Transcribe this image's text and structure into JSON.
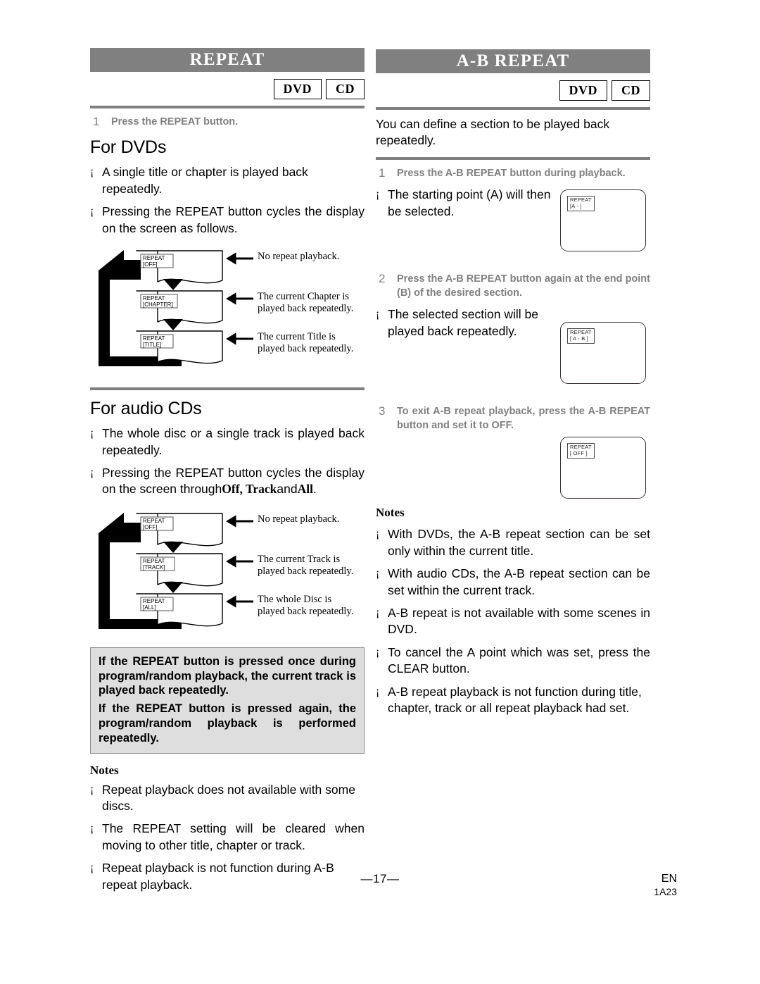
{
  "left_column": {
    "section_title": "REPEAT",
    "badges": [
      "DVD",
      "CD"
    ],
    "step1": {
      "num": "1",
      "text": "Press the REPEAT button."
    },
    "dvd_heading": "For DVDs",
    "dvd_bullets": [
      "A single title or chapter is played back repeatedly.",
      "Pressing the REPEAT button cycles the display on the screen as follows."
    ],
    "dvd_flow": {
      "items": [
        {
          "osd_line1": "REPEAT",
          "osd_line2": "[OFF]",
          "caption": "No repeat playback."
        },
        {
          "osd_line1": "REPEAT",
          "osd_line2": "[CHAPTER]",
          "caption": "The current Chapter is\nplayed back repeatedly."
        },
        {
          "osd_line1": "REPEAT",
          "osd_line2": "[TITLE]",
          "caption": "The current Title is\nplayed back repeatedly."
        }
      ]
    },
    "cd_heading": "For audio CDs",
    "cd_bullet1": "The whole disc or a single track is played back repeatedly.",
    "cd_bullet2_pre": "Pressing the REPEAT button cycles the display on the screen through",
    "cd_bullet2_b1": "Off, Track",
    "cd_bullet2_mid": "and",
    "cd_bullet2_b2": "All",
    "cd_bullet2_end": ".",
    "cd_flow": {
      "items": [
        {
          "osd_line1": "REPEAT",
          "osd_line2": "[OFF]",
          "caption": "No repeat playback."
        },
        {
          "osd_line1": "REPEAT",
          "osd_line2": "[TRACK]",
          "caption": "The current Track is\nplayed back repeatedly."
        },
        {
          "osd_line1": "REPEAT",
          "osd_line2": "[ALL]",
          "caption": "The whole Disc is\nplayed back repeatedly."
        }
      ]
    },
    "callout": [
      "If the REPEAT button is pressed once during program/random playback, the current track is played back repeatedly.",
      "If the REPEAT button is pressed again, the program/random playback is performed repeatedly."
    ],
    "notes_title": "Notes",
    "notes": [
      "Repeat playback does not available with some discs.",
      "The REPEAT setting will be cleared when moving to other title, chapter or track.",
      "Repeat playback is not function during A-B repeat playback."
    ]
  },
  "right_column": {
    "section_title": "A-B REPEAT",
    "badges": [
      "DVD",
      "CD"
    ],
    "intro": "You can define a section to be played back repeatedly.",
    "step1": {
      "num": "1",
      "text": "Press the A-B REPEAT button during playback."
    },
    "step1_bullet": "The starting point (A) will then be selected.",
    "screen1": {
      "line1": "REPEAT",
      "line2": "[A -    ]"
    },
    "step2": {
      "num": "2",
      "text": "Press the A-B REPEAT button again at the end point (B) of the desired section."
    },
    "step2_bullet": "The selected section will be played back repeatedly.",
    "screen2": {
      "line1": "REPEAT",
      "line2": "[ A - B ]"
    },
    "step3": {
      "num": "3",
      "text": "To exit A-B repeat playback, press the A-B REPEAT button and set it to OFF."
    },
    "screen3": {
      "line1": "REPEAT",
      "line2": "[ OFF ]"
    },
    "notes_title": "Notes",
    "notes": [
      "With DVDs, the A-B repeat section can be set only within the current title.",
      "With audio CDs, the A-B repeat section can be set within the current track.",
      "A-B repeat is not available with some scenes in DVD.",
      "To cancel the A point which was set, press the CLEAR button.",
      "A-B repeat playback is not function during title, chapter, track or all repeat playback had set."
    ]
  },
  "footer": {
    "page_number": "—17—",
    "lang": "EN",
    "code": "1A23"
  },
  "bullet_glyph": "¡",
  "colors": {
    "header_bar": "#808080",
    "rule": "#808080",
    "step_text": "#808080",
    "callout_bg": "#dedede"
  }
}
